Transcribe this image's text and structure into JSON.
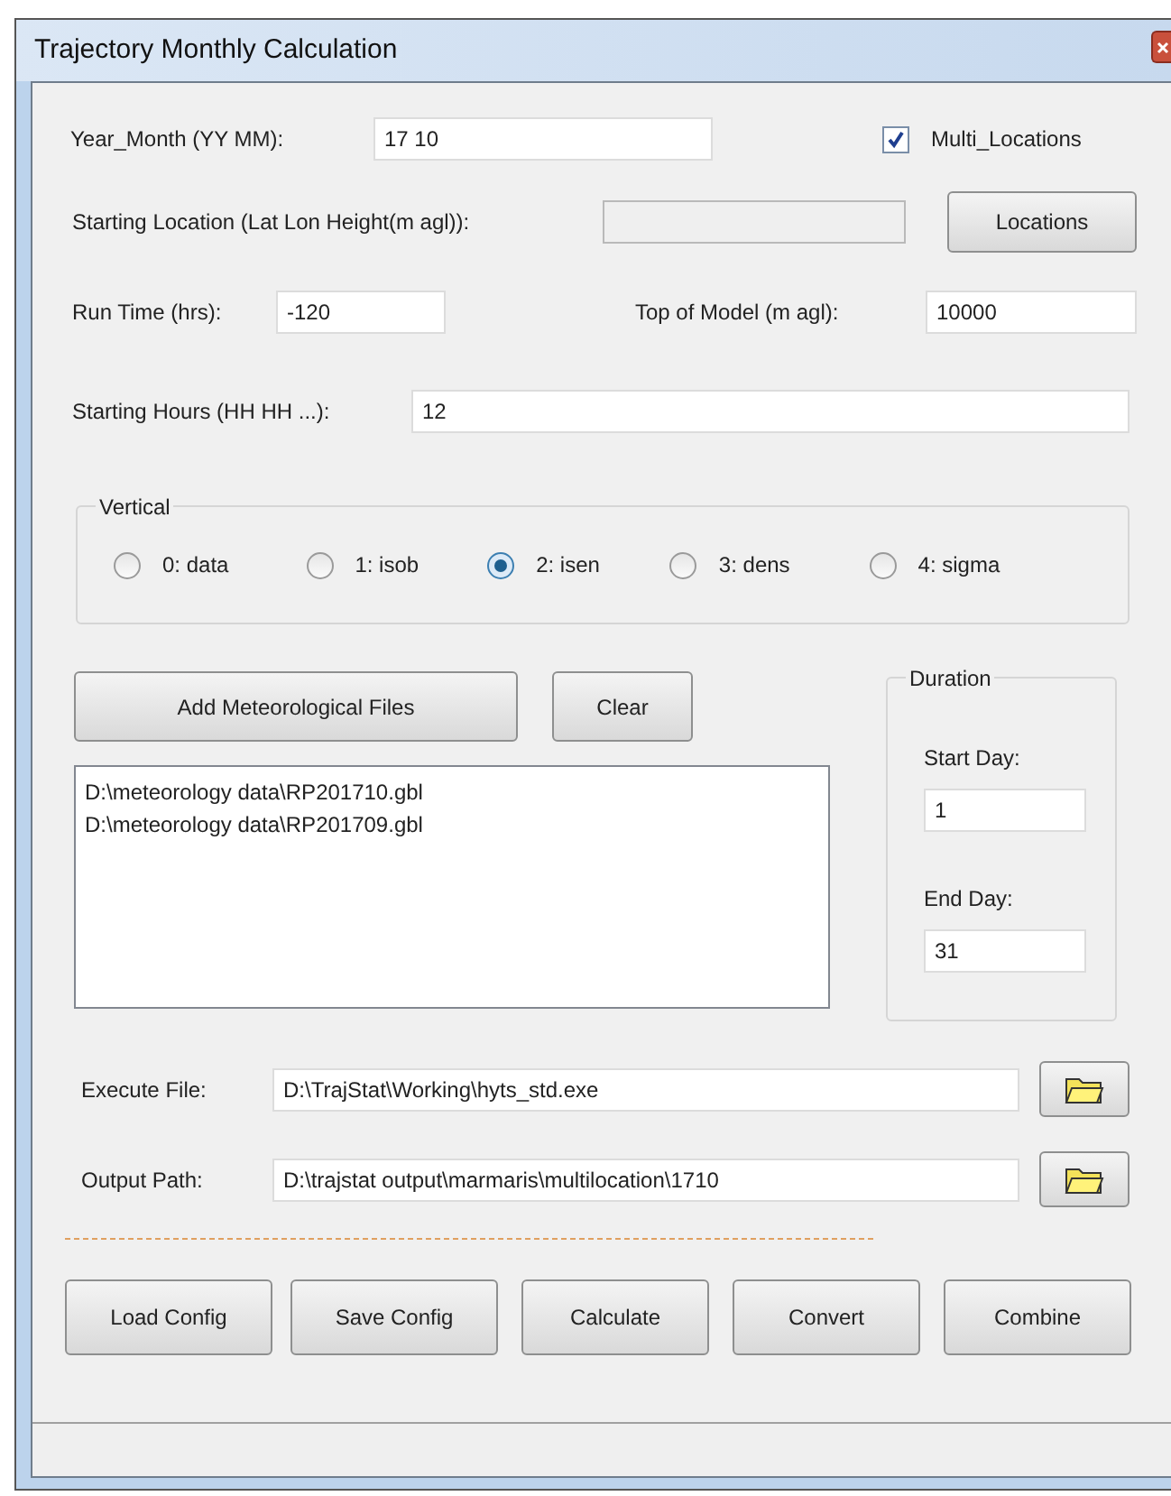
{
  "window": {
    "title": "Trajectory Monthly Calculation"
  },
  "year_month": {
    "label": "Year_Month (YY MM):",
    "value": "17 10"
  },
  "multi_locations": {
    "label": "Multi_Locations",
    "checked": true
  },
  "starting_location": {
    "label": "Starting Location (Lat Lon Height(m agl)):",
    "disabled": true
  },
  "locations_button": "Locations",
  "run_time": {
    "label": "Run Time (hrs):",
    "value": "-120"
  },
  "top_of_model": {
    "label": "Top of Model (m agl):",
    "value": "10000"
  },
  "starting_hours": {
    "label": "Starting Hours (HH HH ...):",
    "value": "12"
  },
  "vertical": {
    "title": "Vertical",
    "options": [
      {
        "label": "0: data",
        "selected": false
      },
      {
        "label": "1: isob",
        "selected": false
      },
      {
        "label": "2: isen",
        "selected": true
      },
      {
        "label": "3: dens",
        "selected": false
      },
      {
        "label": "4: sigma",
        "selected": false
      }
    ]
  },
  "add_files_button": "Add Meteorological Files",
  "clear_button": "Clear",
  "files": [
    "D:\\meteorology data\\RP201710.gbl",
    "D:\\meteorology data\\RP201709.gbl"
  ],
  "duration": {
    "title": "Duration",
    "start_label": "Start Day:",
    "start_value": "1",
    "end_label": "End Day:",
    "end_value": "31"
  },
  "execute_file": {
    "label": "Execute File:",
    "value": "D:\\TrajStat\\Working\\hyts_std.exe"
  },
  "output_path": {
    "label": "Output Path:",
    "value": "D:\\trajstat output\\marmaris\\multilocation\\1710"
  },
  "buttons": [
    "Load Config",
    "Save Config",
    "Calculate",
    "Convert",
    "Combine"
  ]
}
